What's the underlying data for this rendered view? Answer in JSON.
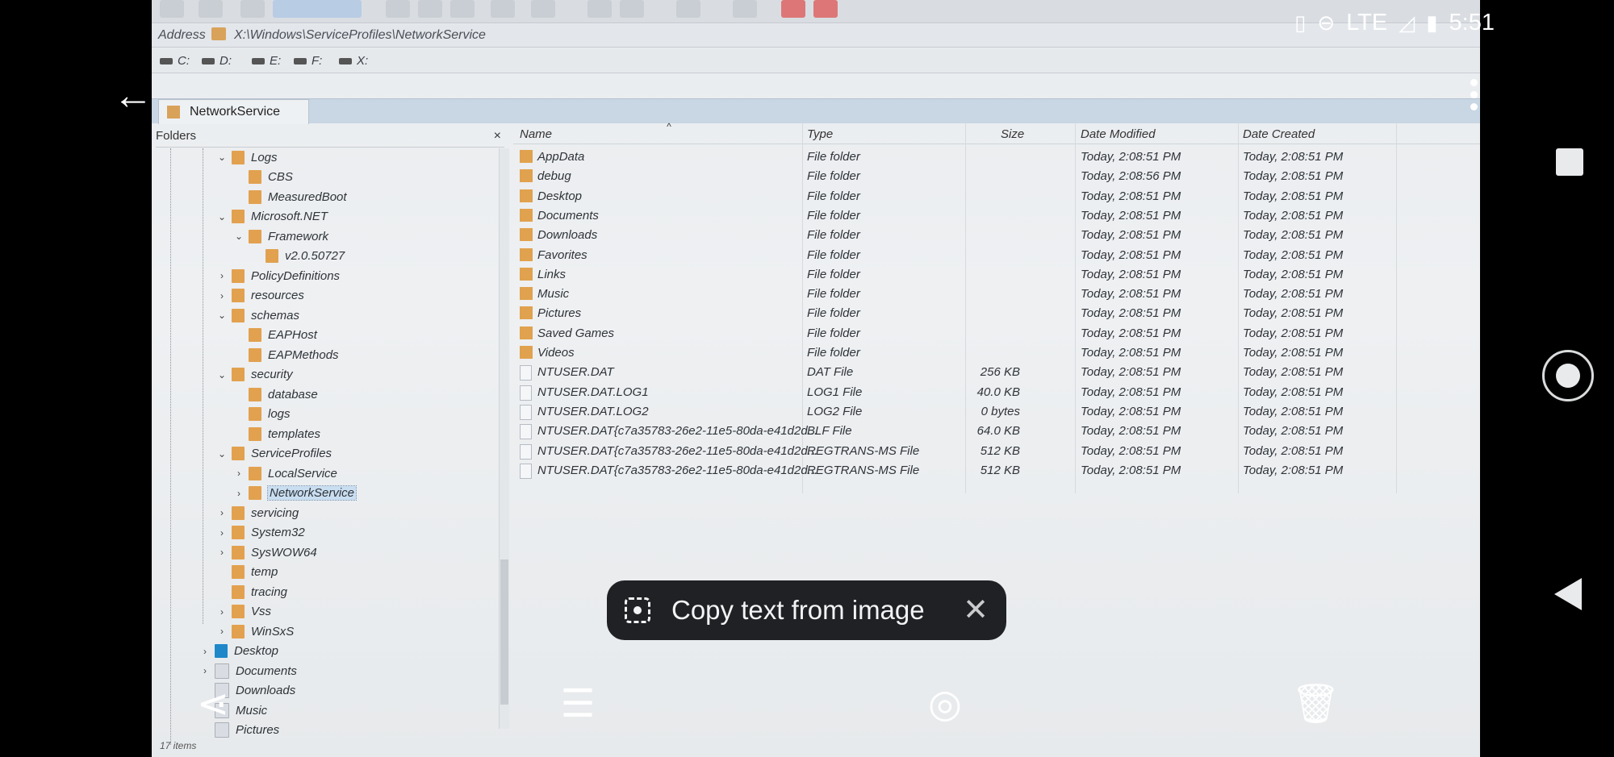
{
  "status_bar": {
    "lte": "LTE",
    "time": "5:51"
  },
  "address": {
    "label": "Address",
    "path": "X:\\Windows\\ServiceProfiles\\NetworkService"
  },
  "drives": [
    "C:",
    "D:",
    "E:",
    "F:",
    "X:"
  ],
  "tab": {
    "label": "NetworkService"
  },
  "folders_pane": {
    "title": "Folders",
    "close": "×"
  },
  "tree": [
    {
      "label": "Logs",
      "level": 3,
      "expanded": true
    },
    {
      "label": "CBS",
      "level": 4
    },
    {
      "label": "MeasuredBoot",
      "level": 4
    },
    {
      "label": "Microsoft.NET",
      "level": 3,
      "expanded": true
    },
    {
      "label": "Framework",
      "level": 4,
      "expanded": true
    },
    {
      "label": "v2.0.50727",
      "level": 5
    },
    {
      "label": "PolicyDefinitions",
      "level": 3,
      "collapsed": true
    },
    {
      "label": "resources",
      "level": 3,
      "collapsed": true
    },
    {
      "label": "schemas",
      "level": 3,
      "expanded": true
    },
    {
      "label": "EAPHost",
      "level": 4
    },
    {
      "label": "EAPMethods",
      "level": 4
    },
    {
      "label": "security",
      "level": 3,
      "expanded": true
    },
    {
      "label": "database",
      "level": 4
    },
    {
      "label": "logs",
      "level": 4
    },
    {
      "label": "templates",
      "level": 4
    },
    {
      "label": "ServiceProfiles",
      "level": 3,
      "expanded": true
    },
    {
      "label": "LocalService",
      "level": 4,
      "collapsed": true
    },
    {
      "label": "NetworkService",
      "level": 4,
      "collapsed": true,
      "selected": true
    },
    {
      "label": "servicing",
      "level": 3,
      "collapsed": true
    },
    {
      "label": "System32",
      "level": 3,
      "collapsed": true
    },
    {
      "label": "SysWOW64",
      "level": 3,
      "collapsed": true
    },
    {
      "label": "temp",
      "level": 3
    },
    {
      "label": "tracing",
      "level": 3
    },
    {
      "label": "Vss",
      "level": 3,
      "collapsed": true
    },
    {
      "label": "WinSxS",
      "level": 3,
      "collapsed": true
    },
    {
      "label": "Desktop",
      "level": 1,
      "collapsed": true,
      "icon": "blue"
    },
    {
      "label": "Documents",
      "level": 1,
      "collapsed": true,
      "icon": "doc"
    },
    {
      "label": "Downloads",
      "level": 1,
      "icon": "doc"
    },
    {
      "label": "Music",
      "level": 1,
      "icon": "doc"
    },
    {
      "label": "Pictures",
      "level": 1,
      "icon": "doc"
    }
  ],
  "columns": {
    "name": "Name",
    "type": "Type",
    "size": "Size",
    "modified": "Date Modified",
    "created": "Date Created"
  },
  "files": [
    {
      "name": "AppData",
      "type": "File folder",
      "size": "",
      "modified": "Today, 2:08:51 PM",
      "created": "Today, 2:08:51 PM",
      "folder": true
    },
    {
      "name": "debug",
      "type": "File folder",
      "size": "",
      "modified": "Today, 2:08:56 PM",
      "created": "Today, 2:08:51 PM",
      "folder": true
    },
    {
      "name": "Desktop",
      "type": "File folder",
      "size": "",
      "modified": "Today, 2:08:51 PM",
      "created": "Today, 2:08:51 PM",
      "folder": true
    },
    {
      "name": "Documents",
      "type": "File folder",
      "size": "",
      "modified": "Today, 2:08:51 PM",
      "created": "Today, 2:08:51 PM",
      "folder": true
    },
    {
      "name": "Downloads",
      "type": "File folder",
      "size": "",
      "modified": "Today, 2:08:51 PM",
      "created": "Today, 2:08:51 PM",
      "folder": true
    },
    {
      "name": "Favorites",
      "type": "File folder",
      "size": "",
      "modified": "Today, 2:08:51 PM",
      "created": "Today, 2:08:51 PM",
      "folder": true
    },
    {
      "name": "Links",
      "type": "File folder",
      "size": "",
      "modified": "Today, 2:08:51 PM",
      "created": "Today, 2:08:51 PM",
      "folder": true
    },
    {
      "name": "Music",
      "type": "File folder",
      "size": "",
      "modified": "Today, 2:08:51 PM",
      "created": "Today, 2:08:51 PM",
      "folder": true
    },
    {
      "name": "Pictures",
      "type": "File folder",
      "size": "",
      "modified": "Today, 2:08:51 PM",
      "created": "Today, 2:08:51 PM",
      "folder": true
    },
    {
      "name": "Saved Games",
      "type": "File folder",
      "size": "",
      "modified": "Today, 2:08:51 PM",
      "created": "Today, 2:08:51 PM",
      "folder": true
    },
    {
      "name": "Videos",
      "type": "File folder",
      "size": "",
      "modified": "Today, 2:08:51 PM",
      "created": "Today, 2:08:51 PM",
      "folder": true
    },
    {
      "name": "NTUSER.DAT",
      "type": "DAT File",
      "size": "256 KB",
      "modified": "Today, 2:08:51 PM",
      "created": "Today, 2:08:51 PM"
    },
    {
      "name": "NTUSER.DAT.LOG1",
      "type": "LOG1 File",
      "size": "40.0 KB",
      "modified": "Today, 2:08:51 PM",
      "created": "Today, 2:08:51 PM"
    },
    {
      "name": "NTUSER.DAT.LOG2",
      "type": "LOG2 File",
      "size": "0 bytes",
      "modified": "Today, 2:08:51 PM",
      "created": "Today, 2:08:51 PM"
    },
    {
      "name": "NTUSER.DAT{c7a35783-26e2-11e5-80da-e41d2d...",
      "type": "BLF File",
      "size": "64.0 KB",
      "modified": "Today, 2:08:51 PM",
      "created": "Today, 2:08:51 PM"
    },
    {
      "name": "NTUSER.DAT{c7a35783-26e2-11e5-80da-e41d2d...",
      "type": "REGTRANS-MS File",
      "size": "512 KB",
      "modified": "Today, 2:08:51 PM",
      "created": "Today, 2:08:51 PM"
    },
    {
      "name": "NTUSER.DAT{c7a35783-26e2-11e5-80da-e41d2d...",
      "type": "REGTRANS-MS File",
      "size": "512 KB",
      "modified": "Today, 2:08:51 PM",
      "created": "Today, 2:08:51 PM"
    }
  ],
  "status": "17 items",
  "lens_chip": {
    "label": "Copy text from image"
  }
}
